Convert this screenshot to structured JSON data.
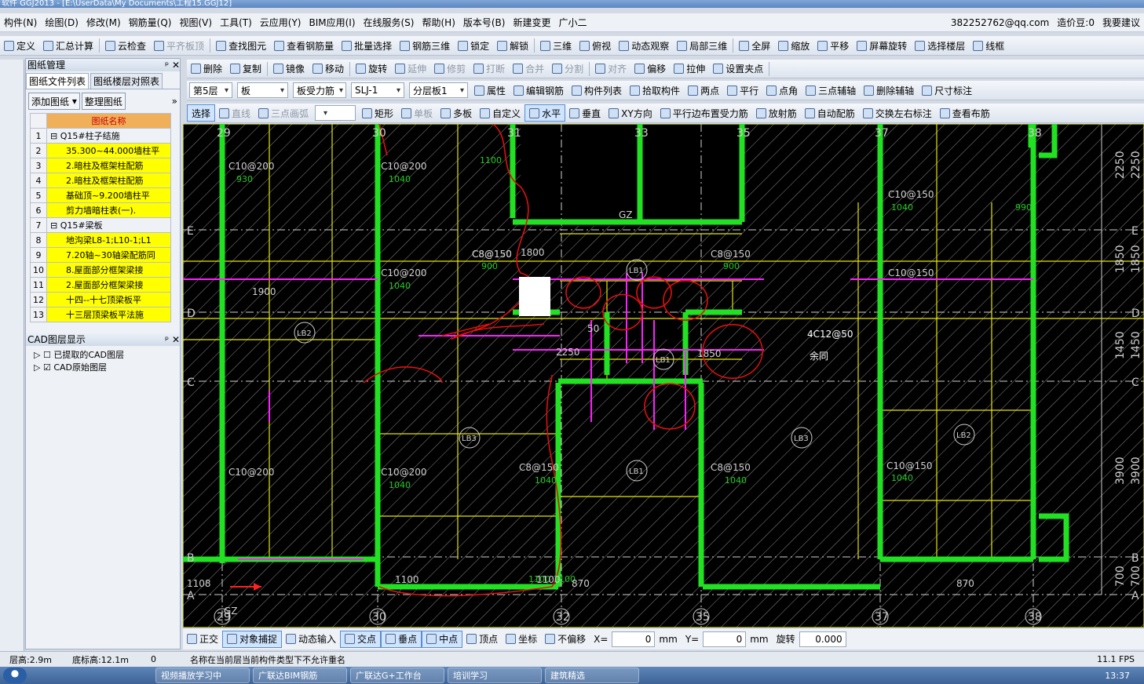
{
  "window": {
    "title": "软件 GGJ2013 - [E:\\UserData\\My Documents\\工程15.GGJ12]"
  },
  "menu": [
    "构件(N)",
    "绘图(D)",
    "修改(M)",
    "钢筋量(Q)",
    "视图(V)",
    "工具(T)",
    "云应用(Y)",
    "BIM应用(I)",
    "在线服务(S)",
    "帮助(H)",
    "版本号(B)",
    "新建变更",
    "广小二"
  ],
  "account": {
    "email": "382252762@qq.com",
    "coins": "造价豆:0",
    "suggest": "我要建议"
  },
  "toolbar1": [
    "定义",
    "汇总计算",
    "云检查",
    "平齐板顶",
    "查找图元",
    "查看钢筋量",
    "批量选择",
    "钢筋三维",
    "锁定",
    "解锁",
    "三维",
    "俯视",
    "动态观察",
    "局部三维",
    "全屏",
    "缩放",
    "平移",
    "屏幕旋转",
    "选择楼层",
    "线框"
  ],
  "toolbar2": [
    "删除",
    "复制",
    "镜像",
    "移动",
    "旋转",
    "延伸",
    "修剪",
    "打断",
    "合并",
    "分割",
    "对齐",
    "偏移",
    "拉伸",
    "设置夹点"
  ],
  "toolbar3": {
    "floor": "第5层",
    "type": "板",
    "subtype": "板受力筋",
    "code": "SLJ-1",
    "layer": "分层板1",
    "items": [
      "属性",
      "编辑钢筋",
      "构件列表",
      "拾取构件",
      "两点",
      "平行",
      "点角",
      "三点辅轴",
      "删除辅轴",
      "尺寸标注"
    ]
  },
  "toolbar4": {
    "select": "选择",
    "items": [
      "直线",
      "三点画弧",
      "矩形",
      "单板",
      "多板",
      "自定义",
      "水平",
      "垂直",
      "XY方向",
      "平行边布置受力筋",
      "放射筋",
      "自动配筋",
      "交换左右标注",
      "查看布筋"
    ]
  },
  "panel": {
    "title": "图纸管理",
    "tabs": [
      "图纸文件列表",
      "图纸楼层对照表"
    ],
    "buttons": [
      "添加图纸",
      "整理图纸"
    ],
    "header": "图纸名称",
    "rows": [
      {
        "n": "1",
        "text": "Q15#柱子结施",
        "group": true
      },
      {
        "n": "2",
        "text": "35.300~44.000墙柱平"
      },
      {
        "n": "3",
        "text": "2.暗柱及框架柱配筋"
      },
      {
        "n": "4",
        "text": "2.暗柱及框架柱配筋"
      },
      {
        "n": "5",
        "text": "基础顶~9.200墙柱平"
      },
      {
        "n": "6",
        "text": "剪力墙暗柱表(一)."
      },
      {
        "n": "7",
        "text": "Q15#梁板",
        "group": true
      },
      {
        "n": "8",
        "text": "地沟梁L8-1;L10-1;L1"
      },
      {
        "n": "9",
        "text": "7.20轴~30轴梁配筋同"
      },
      {
        "n": "10",
        "text": "8.屋面部分框架梁接"
      },
      {
        "n": "11",
        "text": "2.屋面部分框架梁接"
      },
      {
        "n": "12",
        "text": "十四--十七顶梁板平"
      },
      {
        "n": "13",
        "text": "十三层顶梁板平法施"
      }
    ],
    "cad_title": "CAD图层显示",
    "cad_items": [
      "已提取的CAD图层",
      "CAD原始图层"
    ]
  },
  "drawing": {
    "axes_bottom": [
      "29",
      "30",
      "32",
      "35",
      "37",
      "38"
    ],
    "axes_top": [
      "29",
      "30",
      "31",
      "33",
      "35",
      "37",
      "38"
    ],
    "axes_left": [
      "E",
      "D",
      "C",
      "B",
      "A"
    ],
    "rebar_labels": [
      "C10@200",
      "C10@200",
      "C10@200",
      "C10@200",
      "C8@150",
      "C8@150",
      "C8@150",
      "C10@150",
      "C10@150",
      "C10@150",
      "C10@200",
      "C8@150",
      "C8@150"
    ],
    "num_labels": [
      "930",
      "1040",
      "1040",
      "1040",
      "1100",
      "1100",
      "1100",
      "990",
      "1040",
      "1040",
      "1040",
      "1040",
      "900",
      "900"
    ],
    "beams": [
      "LB2",
      "LB1",
      "LB1",
      "LB3",
      "LB1",
      "LB3",
      "LB2"
    ],
    "misc": [
      "GZ",
      "GZ",
      "1900",
      "1800",
      "2250",
      "1850",
      "50",
      "4C12@50",
      "余同",
      "870",
      "870",
      "1100",
      "1100",
      "1108"
    ],
    "dims_right": [
      "2250",
      "1850",
      "1450",
      "3900",
      "700"
    ]
  },
  "statusbar": {
    "items": [
      "正交",
      "对象捕捉",
      "动态输入",
      "交点",
      "垂点",
      "中点",
      "顶点",
      "坐标",
      "不偏移"
    ],
    "x_label": "X=",
    "x_val": "0",
    "y_label": "Y=",
    "y_val": "0",
    "unit": "mm",
    "rotate_label": "旋转",
    "rotate_val": "0.000"
  },
  "infobar": {
    "floor_h": "层高:2.9m",
    "base_h": "底标高:12.1m",
    "zero": "0",
    "message": "名称在当前层当前构件类型下不允许重名",
    "fps": "11.1 FPS"
  },
  "taskbar": {
    "tasks": [
      "视频播放学习中",
      "广联达BIM钢筋",
      "广联达G+工作台",
      "培训学习",
      "建筑精选"
    ],
    "time": "13:37"
  }
}
